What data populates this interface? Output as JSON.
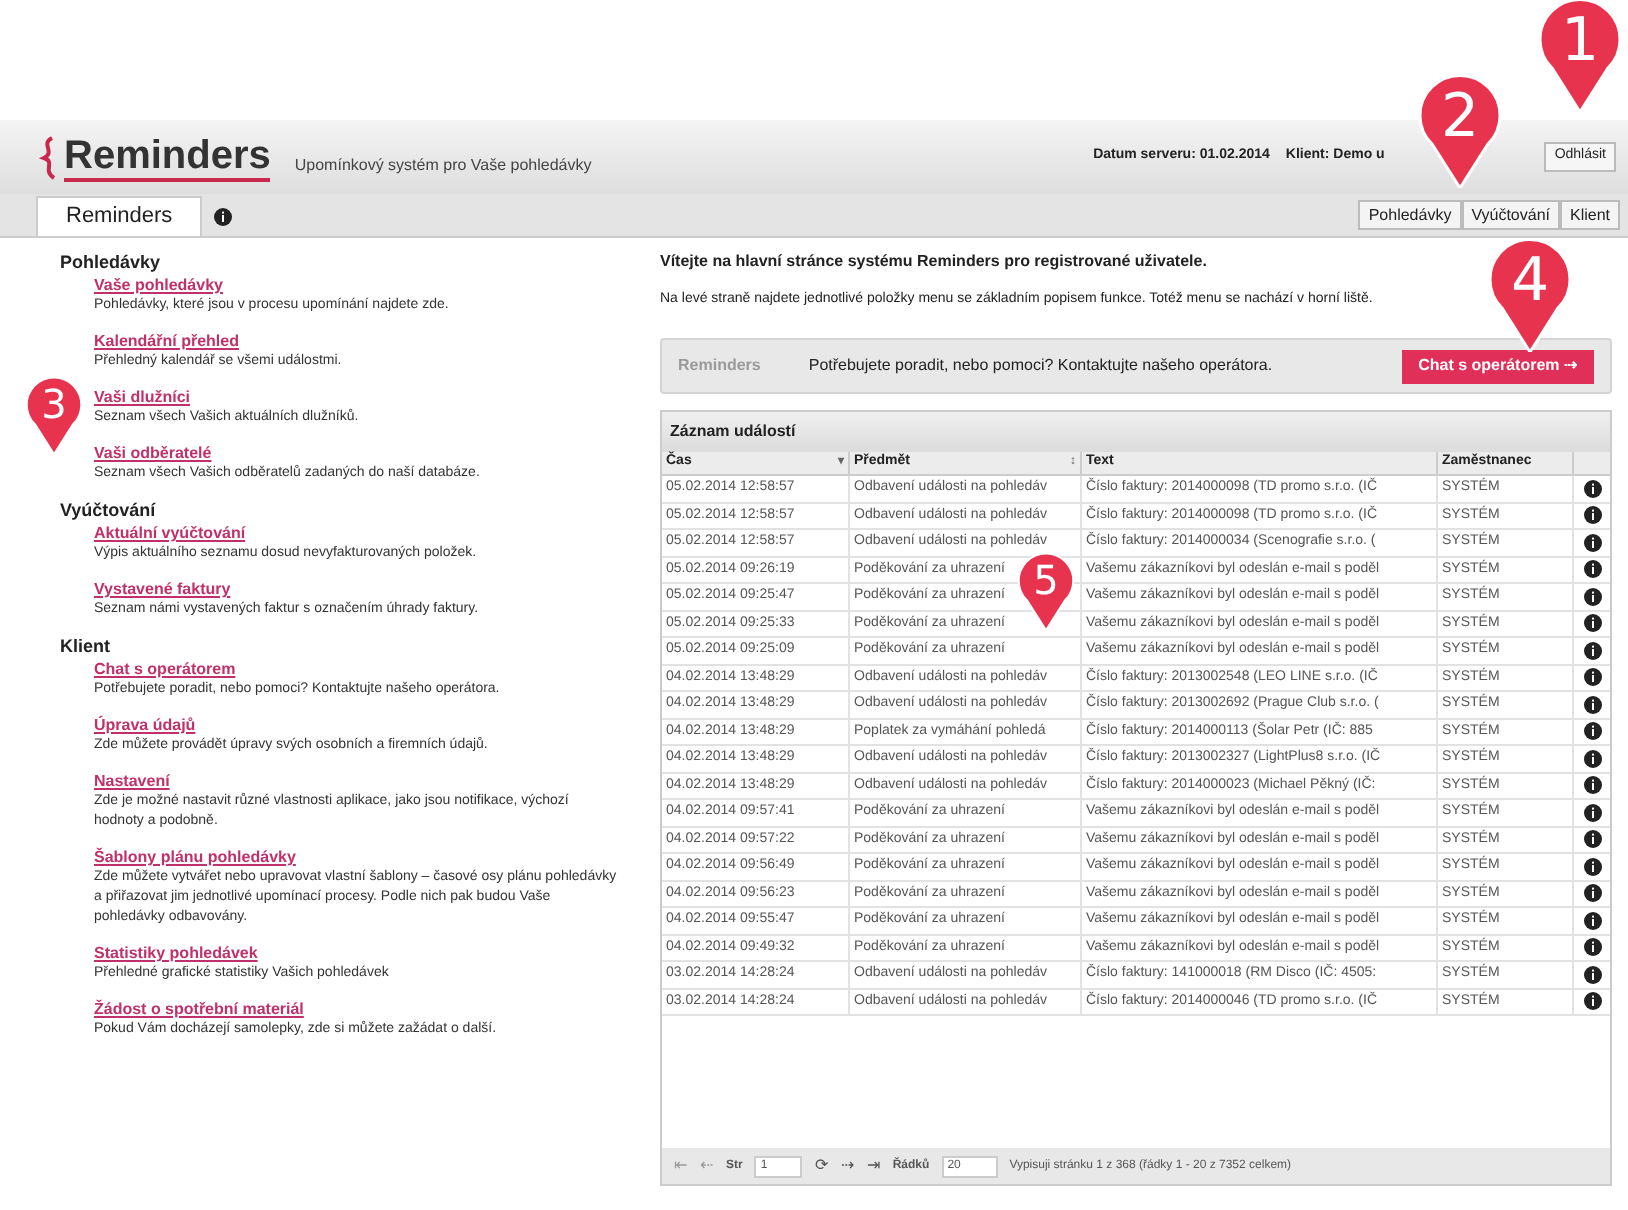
{
  "header": {
    "logo": "Reminders",
    "tagline": "Upomínkový systém pro Vaše pohledávky",
    "server_date_label": "Datum serveru:",
    "server_date": "01.02.2014",
    "client": "Klient: Demo u",
    "logout": "Odhlásit"
  },
  "tabs": [
    {
      "label": "Reminders",
      "selected": true
    }
  ],
  "top_menu": [
    {
      "label": "Pohledávky"
    },
    {
      "label": "Vyúčtování"
    },
    {
      "label": "Klient"
    }
  ],
  "sidebar": [
    {
      "title": "Pohledávky",
      "items": [
        {
          "link": "Vaše pohledávky",
          "desc": "Pohledávky, které jsou v procesu upomínání najdete zde."
        },
        {
          "link": "Kalendářní přehled",
          "desc": "Přehledný kalendář se všemi událostmi."
        },
        {
          "link": "Vaši dlužníci",
          "desc": "Seznam všech Vašich aktuálních dlužníků."
        },
        {
          "link": "Vaši odběratelé",
          "desc": "Seznam všech Vašich odběratelů zadaných do naší databáze."
        }
      ]
    },
    {
      "title": "Vyúčtování",
      "items": [
        {
          "link": "Aktuální vyúčtování",
          "desc": "Výpis aktuálního seznamu dosud nevyfakturovaných položek."
        },
        {
          "link": "Vystavené faktury",
          "desc": "Seznam námi vystavených faktur s označením úhrady faktury."
        }
      ]
    },
    {
      "title": "Klient",
      "items": [
        {
          "link": "Chat s operátorem",
          "desc": "Potřebujete poradit, nebo pomoci? Kontaktujte našeho operátora."
        },
        {
          "link": "Úprava údajů",
          "desc": "Zde můžete provádět úpravy svých osobních a firemních údajů."
        },
        {
          "link": "Nastavení",
          "desc": "Zde je možné nastavit různé vlastnosti aplikace, jako jsou notifikace, výchozí hodnoty a podobně."
        },
        {
          "link": "Šablony plánu pohledávky",
          "desc": "Zde můžete vytvářet nebo upravovat vlastní šablony – časové osy plánu pohledávky a přiřazovat jim jednotlivé upomínací procesy. Podle nich pak budou Vaše pohledávky odbavovány."
        },
        {
          "link": "Statistiky pohledávek",
          "desc": "Přehledné grafické statistiky Vašich pohledávek"
        },
        {
          "link": "Žádost o spotřební materiál",
          "desc": "Pokud Vám docházejí samolepky, zde si můžete zažádat o další."
        }
      ]
    }
  ],
  "welcome": "Vítejte na hlavní stránce systému Reminders pro registrované uživatele.",
  "intro": "Na levé straně najdete jednotlivé položky menu se základním popisem funkce. Totéž menu se nachází v horní liště.",
  "help_banner": {
    "logo": "Reminders",
    "text": "Potřebujete poradit, nebo pomoci? Kontaktujte našeho operátora.",
    "button": "Chat s operátorem ⇢"
  },
  "event_log": {
    "title": "Záznam událostí",
    "columns": [
      {
        "label": "Čas",
        "sort": "▾"
      },
      {
        "label": "Předmět",
        "sort": "↕"
      },
      {
        "label": "Text"
      },
      {
        "label": "Zaměstnanec"
      }
    ],
    "rows": [
      [
        "05.02.2014 12:58:57",
        "Odbavení události na pohledáv",
        "Číslo faktury: 2014000098 (TD promo s.r.o. (IČ",
        "SYSTÉM"
      ],
      [
        "05.02.2014 12:58:57",
        "Odbavení události na pohledáv",
        "Číslo faktury: 2014000098 (TD promo s.r.o. (IČ",
        "SYSTÉM"
      ],
      [
        "05.02.2014 12:58:57",
        "Odbavení události na pohledáv",
        "Číslo faktury: 2014000034 (Scenografie s.r.o. (",
        "SYSTÉM"
      ],
      [
        "05.02.2014 09:26:19",
        "Poděkování za uhrazení",
        "Vašemu zákazníkovi byl odeslán e-mail s poděl",
        "SYSTÉM"
      ],
      [
        "05.02.2014 09:25:47",
        "Poděkování za uhrazení",
        "Vašemu zákazníkovi byl odeslán e-mail s poděl",
        "SYSTÉM"
      ],
      [
        "05.02.2014 09:25:33",
        "Poděkování za uhrazení",
        "Vašemu zákazníkovi byl odeslán e-mail s poděl",
        "SYSTÉM"
      ],
      [
        "05.02.2014 09:25:09",
        "Poděkování za uhrazení",
        "Vašemu zákazníkovi byl odeslán e-mail s poděl",
        "SYSTÉM"
      ],
      [
        "04.02.2014 13:48:29",
        "Odbavení události na pohledáv",
        "Číslo faktury: 2013002548 (LEO LINE s.r.o. (IČ",
        "SYSTÉM"
      ],
      [
        "04.02.2014 13:48:29",
        "Odbavení události na pohledáv",
        "Číslo faktury: 2013002692 (Prague Club s.r.o. (",
        "SYSTÉM"
      ],
      [
        "04.02.2014 13:48:29",
        "Poplatek za vymáhání pohledá",
        "Číslo faktury: 2014000113 (Šolar Petr (IČ: 885",
        "SYSTÉM"
      ],
      [
        "04.02.2014 13:48:29",
        "Odbavení události na pohledáv",
        "Číslo faktury: 2013002327 (LightPlus8 s.r.o. (IČ",
        "SYSTÉM"
      ],
      [
        "04.02.2014 13:48:29",
        "Odbavení události na pohledáv",
        "Číslo faktury: 2014000023 (Michael Pěkný (IČ:",
        "SYSTÉM"
      ],
      [
        "04.02.2014 09:57:41",
        "Poděkování za uhrazení",
        "Vašemu zákazníkovi byl odeslán e-mail s poděl",
        "SYSTÉM"
      ],
      [
        "04.02.2014 09:57:22",
        "Poděkování za uhrazení",
        "Vašemu zákazníkovi byl odeslán e-mail s poděl",
        "SYSTÉM"
      ],
      [
        "04.02.2014 09:56:49",
        "Poděkování za uhrazení",
        "Vašemu zákazníkovi byl odeslán e-mail s poděl",
        "SYSTÉM"
      ],
      [
        "04.02.2014 09:56:23",
        "Poděkování za uhrazení",
        "Vašemu zákazníkovi byl odeslán e-mail s poděl",
        "SYSTÉM"
      ],
      [
        "04.02.2014 09:55:47",
        "Poděkování za uhrazení",
        "Vašemu zákazníkovi byl odeslán e-mail s poděl",
        "SYSTÉM"
      ],
      [
        "04.02.2014 09:49:32",
        "Poděkování za uhrazení",
        "Vašemu zákazníkovi byl odeslán e-mail s poděl",
        "SYSTÉM"
      ],
      [
        "03.02.2014 14:28:24",
        "Odbavení události na pohledáv",
        "Číslo faktury: 141000018 (RM Disco (IČ: 4505:",
        "SYSTÉM"
      ],
      [
        "03.02.2014 14:28:24",
        "Odbavení události na pohledáv",
        "Číslo faktury: 2014000046 (TD promo s.r.o. (IČ",
        "SYSTÉM"
      ]
    ],
    "pager": {
      "nav_back": [
        "⇤",
        "⇠"
      ],
      "nav_forward": [
        "⟳",
        "⇢",
        "⇥"
      ],
      "page_label": "Str",
      "page": "1",
      "rows_label": "Řádků",
      "rows": "20",
      "summary": "Vypisuji stránku 1 z 368 (řádky 1 - 20 z 7352 celkem)"
    }
  },
  "markers": [
    {
      "label": "1"
    },
    {
      "label": "2"
    },
    {
      "label": "3"
    },
    {
      "label": "4"
    },
    {
      "label": "5"
    }
  ]
}
